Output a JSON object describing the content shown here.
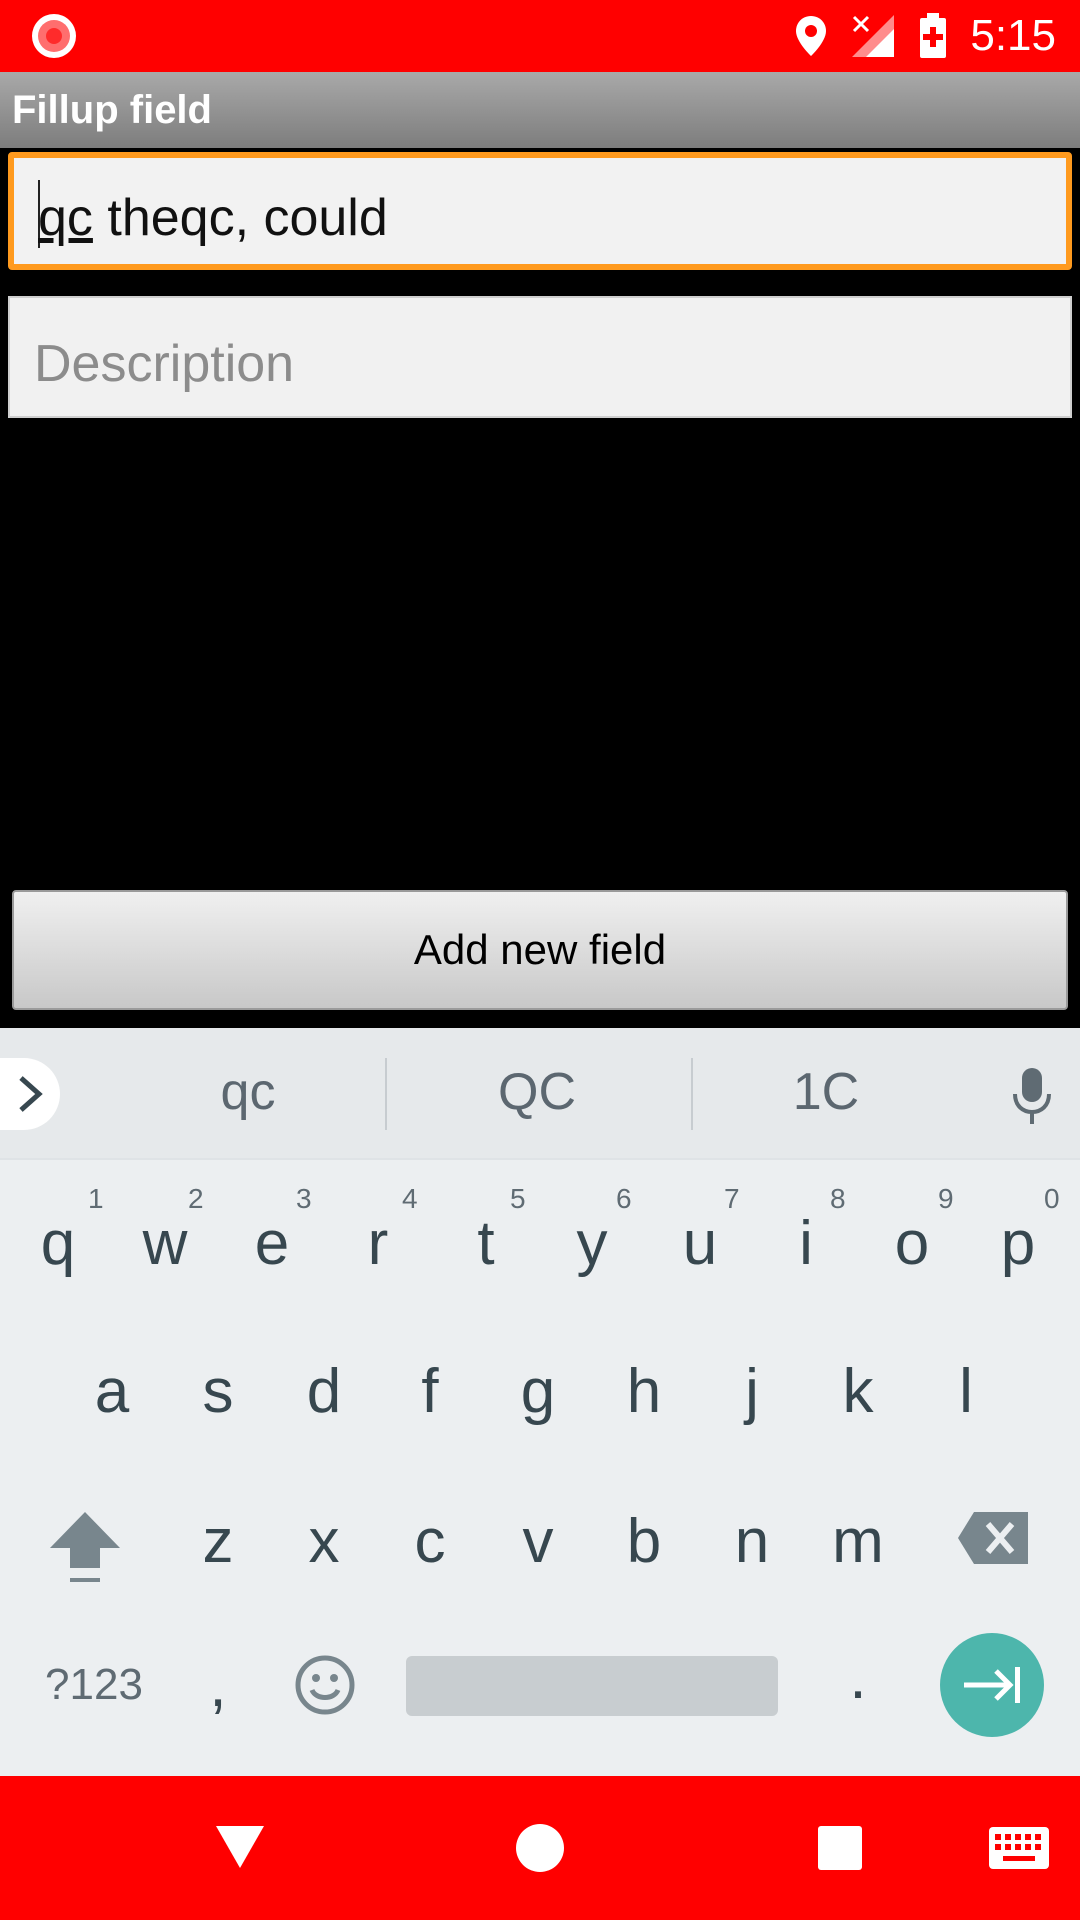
{
  "status_bar": {
    "time": "5:15"
  },
  "title_bar": {
    "title": "Fillup field"
  },
  "form": {
    "title_value_underlined": "qc",
    "title_value_rest": " theqc, could",
    "description_placeholder": "Description",
    "add_button_label": "Add new field"
  },
  "keyboard": {
    "suggestions": [
      "qc",
      "QC",
      "1C"
    ],
    "row1": [
      "q",
      "w",
      "e",
      "r",
      "t",
      "y",
      "u",
      "i",
      "o",
      "p"
    ],
    "row1_numbers": [
      "1",
      "2",
      "3",
      "4",
      "5",
      "6",
      "7",
      "8",
      "9",
      "0"
    ],
    "row2": [
      "a",
      "s",
      "d",
      "f",
      "g",
      "h",
      "j",
      "k",
      "l"
    ],
    "row3": [
      "z",
      "x",
      "c",
      "v",
      "b",
      "n",
      "m"
    ],
    "symbols_key": "?123",
    "comma_key": ",",
    "period_key": ".",
    "accent_color": "#4db6ac"
  },
  "colors": {
    "status_bar": "#ff0000",
    "focus_border": "#ff9a1e"
  }
}
